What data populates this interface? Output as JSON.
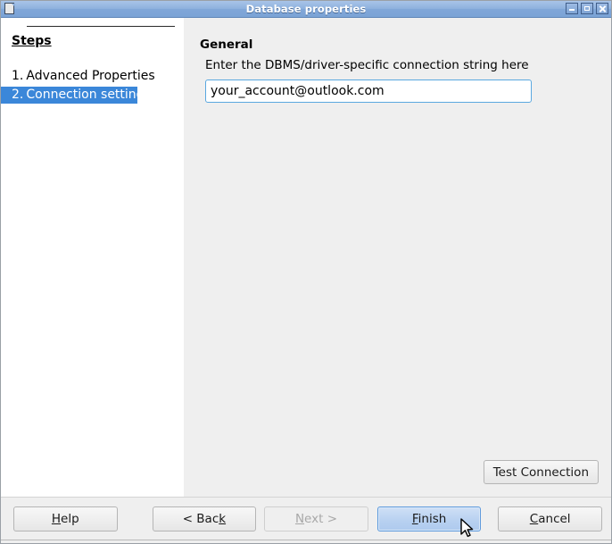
{
  "window": {
    "title": "Database properties",
    "icon": "document-icon",
    "controls": {
      "minimize": "minimize-icon",
      "maximize": "maximize-icon",
      "close": "close-icon"
    }
  },
  "sidebar": {
    "heading": "Steps",
    "items": [
      {
        "number": "1.",
        "label": "Advanced Properties",
        "selected": false
      },
      {
        "number": "2.",
        "label": "Connection settings",
        "selected": true
      }
    ],
    "selected_color": "#3b87d9"
  },
  "main": {
    "group_title": "General",
    "field_label": "Enter the DBMS/driver-specific connection string here",
    "connection_string": {
      "value": "your_account@outlook.com",
      "placeholder": ""
    },
    "test_connection_label": "Test Connection"
  },
  "footer": {
    "help": {
      "pre": "",
      "mnemonic": "H",
      "post": "elp"
    },
    "back": {
      "pre": "< Bac",
      "mnemonic": "k",
      "post": ""
    },
    "next": {
      "pre": "",
      "mnemonic": "N",
      "post": "ext >",
      "enabled": false
    },
    "finish": {
      "pre": "",
      "mnemonic": "F",
      "post": "inish",
      "default": true
    },
    "cancel": {
      "pre": "",
      "mnemonic": "C",
      "post": "ancel"
    }
  },
  "cursor": {
    "type": "arrow-pointer"
  }
}
